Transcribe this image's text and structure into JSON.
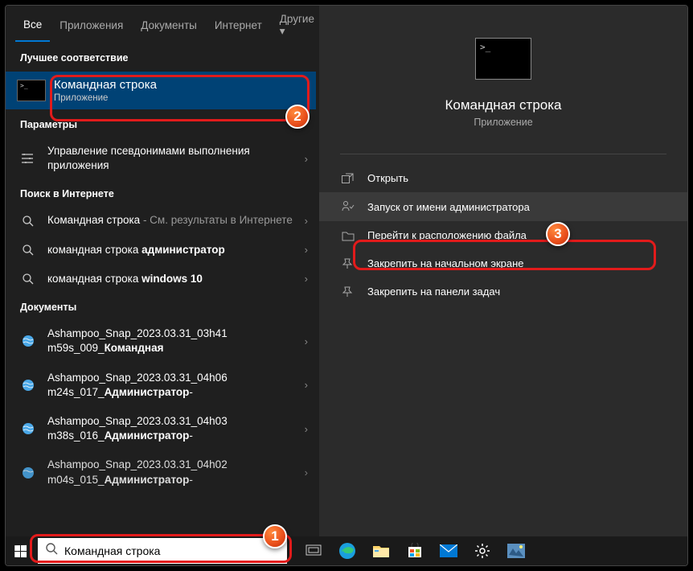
{
  "tabs": {
    "all": "Все",
    "apps": "Приложения",
    "docs": "Документы",
    "web": "Интернет",
    "other": "Другие"
  },
  "sections": {
    "best_match": "Лучшее соответствие",
    "settings": "Параметры",
    "web_search": "Поиск в Интернете",
    "documents": "Документы"
  },
  "best": {
    "title": "Командная строка",
    "sub": "Приложение"
  },
  "settings_items": [
    {
      "text": "Управление псевдонимами выполнения приложения"
    }
  ],
  "web_items": [
    {
      "pre": "Командная строка",
      "post": " - См. результаты в Интернете"
    },
    {
      "pre": "командная строка ",
      "bold": "администратор"
    },
    {
      "pre": "командная строка ",
      "bold": "windows 10"
    }
  ],
  "doc_items": [
    {
      "l1": "Ashampoo_Snap_2023.03.31_03h41",
      "l2_pre": "m59s_009_",
      "l2_bold": "Командная"
    },
    {
      "l1": "Ashampoo_Snap_2023.03.31_04h06",
      "l2_pre": "m24s_017_",
      "l2_bold": "Администратор",
      "l2_post": "-"
    },
    {
      "l1": "Ashampoo_Snap_2023.03.31_04h03",
      "l2_pre": "m38s_016_",
      "l2_bold": "Администратор",
      "l2_post": "-"
    },
    {
      "l1": "Ashampoo_Snap_2023.03.31_04h02",
      "l2_pre": "m04s_015_",
      "l2_bold": "Администратор",
      "l2_post": "-"
    }
  ],
  "right": {
    "title": "Командная строка",
    "sub": "Приложение",
    "actions": [
      "Открыть",
      "Запуск от имени администратора",
      "Перейти к расположению файла",
      "Закрепить на начальном экране",
      "Закрепить на панели задач"
    ]
  },
  "search_value": "Командная строка",
  "callouts": {
    "c1": "1",
    "c2": "2",
    "c3": "3"
  }
}
